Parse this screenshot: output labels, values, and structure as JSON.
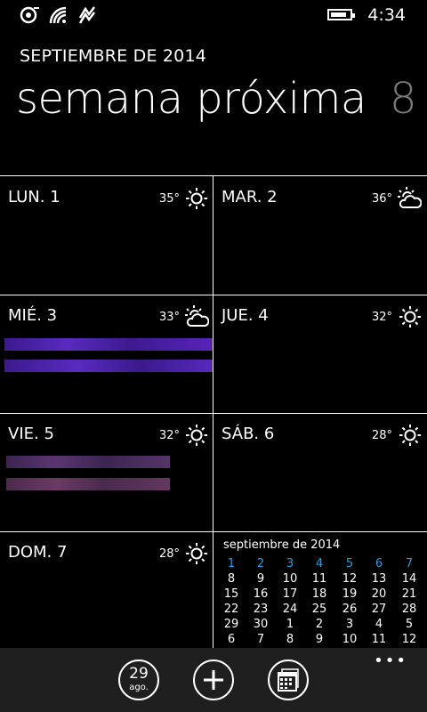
{
  "status_bar": {
    "icons": [
      "sync-icon",
      "wifi-icon",
      "nfc-icon"
    ],
    "battery_icon": "battery-icon",
    "time": "4:34"
  },
  "header": {
    "month": "SEPTIEMBRE DE 2014",
    "title": "semana próxima",
    "week_number": "8"
  },
  "days": [
    {
      "label": "LUN. 1",
      "temp": "35°",
      "weather": "sun-icon"
    },
    {
      "label": "MAR. 2",
      "temp": "36°",
      "weather": "partly-cloudy-icon"
    },
    {
      "label": "MIÉ. 3",
      "temp": "33°",
      "weather": "partly-cloudy-icon"
    },
    {
      "label": "JUE. 4",
      "temp": "32°",
      "weather": "sun-icon"
    },
    {
      "label": "VIE. 5",
      "temp": "32°",
      "weather": "sun-icon"
    },
    {
      "label": "SÁB. 6",
      "temp": "28°",
      "weather": "sun-icon"
    },
    {
      "label": "DOM. 7",
      "temp": "28°",
      "weather": "sun-icon"
    }
  ],
  "events_colors": {
    "wed": "#4a1ea8",
    "fri": "#4a2a5c"
  },
  "mini_calendar": {
    "title": "septiembre de 2014",
    "rows": [
      [
        "1",
        "2",
        "3",
        "4",
        "5",
        "6",
        "7"
      ],
      [
        "8",
        "9",
        "10",
        "11",
        "12",
        "13",
        "14"
      ],
      [
        "15",
        "16",
        "17",
        "18",
        "19",
        "20",
        "21"
      ],
      [
        "22",
        "23",
        "24",
        "25",
        "26",
        "27",
        "28"
      ],
      [
        "29",
        "30",
        "1",
        "2",
        "3",
        "4",
        "5"
      ],
      [
        "6",
        "7",
        "8",
        "9",
        "10",
        "11",
        "12"
      ]
    ],
    "accent": "#1ba1e2"
  },
  "app_bar": {
    "today_day": "29",
    "today_month": "ago.",
    "add_icon": "plus-icon",
    "month_view_icon": "calendar-icon",
    "more_label": "•••"
  }
}
